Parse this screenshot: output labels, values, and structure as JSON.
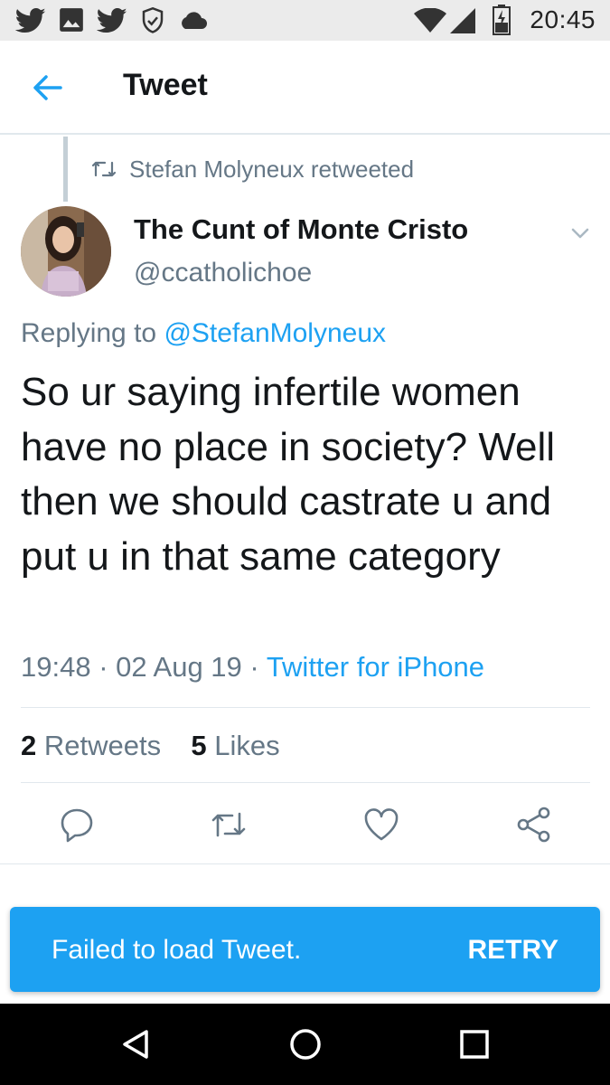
{
  "status_bar": {
    "time": "20:45",
    "left_icons": [
      "twitter-icon",
      "image-icon",
      "twitter-icon",
      "shield-check-icon",
      "cloud-icon"
    ],
    "right_icons": [
      "wifi-icon",
      "signal-icon",
      "battery-charging-icon"
    ]
  },
  "header": {
    "title": "Tweet"
  },
  "tweet": {
    "retweeted_by": "Stefan Molyneux retweeted",
    "author_name": "The Cunt of Monte Cristo",
    "author_handle": "@ccatholichoe",
    "replying_prefix": "Replying to ",
    "replying_to": "@StefanMolyneux",
    "text": "So ur saying infertile women have no place in society? Well then we should castrate u and put u in that same category",
    "time": "19:48",
    "date": "02 Aug 19",
    "source": "Twitter for iPhone",
    "retweet_count": "2",
    "retweet_label": "Retweets",
    "like_count": "5",
    "like_label": "Likes"
  },
  "snackbar": {
    "message": "Failed to load Tweet.",
    "action": "RETRY"
  },
  "colors": {
    "accent": "#1da1f2",
    "secondary_text": "#657786",
    "primary_text": "#14171a"
  }
}
